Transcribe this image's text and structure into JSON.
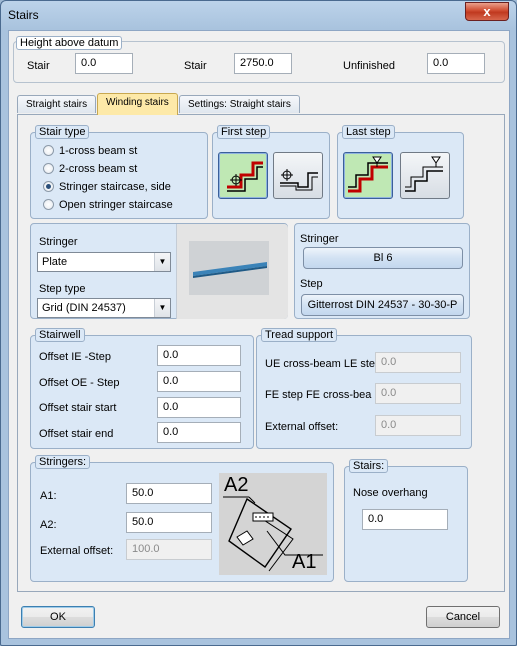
{
  "window": {
    "title": "Stairs",
    "close_glyph": "x"
  },
  "height_datum": {
    "title": "Height above datum",
    "fields": [
      {
        "label": "Stair",
        "value": "0.0"
      },
      {
        "label": "Stair",
        "value": "2750.0"
      },
      {
        "label": "Unfinished",
        "value": "0.0"
      }
    ]
  },
  "tabs": [
    {
      "label": "Straight stairs",
      "active": false
    },
    {
      "label": "Winding stairs",
      "active": true
    },
    {
      "label": "Settings: Straight stairs",
      "active": false
    }
  ],
  "stair_type": {
    "title": "Stair type",
    "options": [
      {
        "label": "1-cross beam st",
        "selected": false
      },
      {
        "label": "2-cross beam st",
        "selected": false
      },
      {
        "label": "Stringer staircase, side",
        "selected": true
      },
      {
        "label": "Open stringer staircase",
        "selected": false
      }
    ]
  },
  "first_step": {
    "title": "First step",
    "icons": [
      "step-start-flat-icon",
      "step-start-raised-icon"
    ]
  },
  "last_step": {
    "title": "Last step",
    "icons": [
      "step-end-flat-icon",
      "step-end-raised-icon"
    ]
  },
  "stringer_cfg": {
    "stringer_label": "Stringer",
    "stringer_value": "Plate",
    "step_type_label": "Step type",
    "step_type_value": "Grid (DIN 24537)",
    "preview_icon": "plate-preview-icon"
  },
  "stringer_info": {
    "stringer_label": "Stringer",
    "stringer_button": "Bl 6",
    "step_label": "Step",
    "step_button": "Gitterrost DIN 24537 - 30-30-P"
  },
  "stairwell": {
    "title": "Stairwell",
    "fields": [
      {
        "label": "Offset IE -Step",
        "value": "0.0"
      },
      {
        "label": "Offset  OE - Step",
        "value": "0.0"
      },
      {
        "label": "Offset stair start",
        "value": "0.0"
      },
      {
        "label": "Offset stair end",
        "value": "0.0"
      }
    ]
  },
  "tread_support": {
    "title": "Tread support",
    "fields": [
      {
        "label": "UE cross-beam LE ste",
        "value": "0.0"
      },
      {
        "label": "FE step FE cross-bea",
        "value": "0.0"
      },
      {
        "label": "External offset:",
        "value": "0.0"
      }
    ]
  },
  "stringers": {
    "title": "Stringers:",
    "fields": [
      {
        "label": "A1:",
        "value": "50.0"
      },
      {
        "label": "A2:",
        "value": "50.0"
      },
      {
        "label": "External offset:",
        "value": "100.0"
      }
    ],
    "diagram": {
      "a2_label": "A2",
      "a1_label": "A1"
    }
  },
  "stairs_box": {
    "title": "Stairs:",
    "nose_label": "Nose overhang",
    "nose_value": "0.0"
  },
  "buttons": {
    "ok": "OK",
    "cancel": "Cancel"
  },
  "colors": {
    "accent_tab": "#fde9a8",
    "group_blue": "#dbe8f6",
    "selected_icon": "#bfe8b4",
    "close_red": "#c0391f"
  }
}
